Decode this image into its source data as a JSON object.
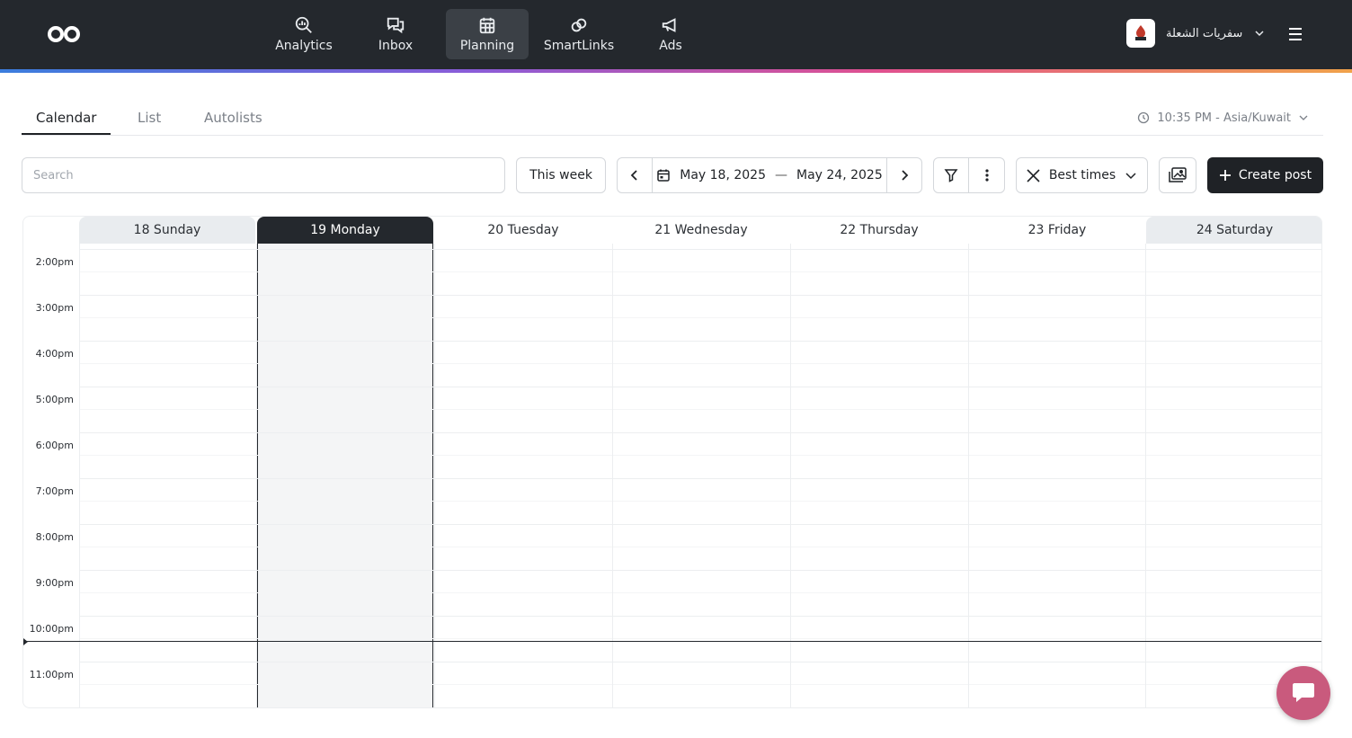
{
  "nav": {
    "items": [
      {
        "label": "Analytics",
        "icon": "analytics-icon"
      },
      {
        "label": "Inbox",
        "icon": "inbox-icon"
      },
      {
        "label": "Planning",
        "icon": "calendar-icon",
        "active": true
      },
      {
        "label": "SmartLinks",
        "icon": "link-icon"
      },
      {
        "label": "Ads",
        "icon": "megaphone-icon"
      }
    ]
  },
  "account": {
    "name": "سفريات الشعلة"
  },
  "tabs": [
    "Calendar",
    "List",
    "Autolists"
  ],
  "timezone": "10:35 PM - Asia/Kuwait",
  "toolbar": {
    "search_placeholder": "Search",
    "this_week": "This week",
    "date_start": "May 18, 2025",
    "date_sep": "—",
    "date_end": "May 24, 2025",
    "best_times": "Best times",
    "create_post": "Create post"
  },
  "calendar": {
    "days": [
      "18 Sunday",
      "19 Monday",
      "20 Tuesday",
      "21 Wednesday",
      "22 Thursday",
      "23 Friday",
      "24 Saturday"
    ],
    "times": [
      "2:00pm",
      "3:00pm",
      "4:00pm",
      "5:00pm",
      "6:00pm",
      "7:00pm",
      "8:00pm",
      "9:00pm",
      "10:00pm",
      "11:00pm"
    ]
  },
  "colors": {
    "topbar": "#24282d",
    "accent": "#c95a7d"
  }
}
